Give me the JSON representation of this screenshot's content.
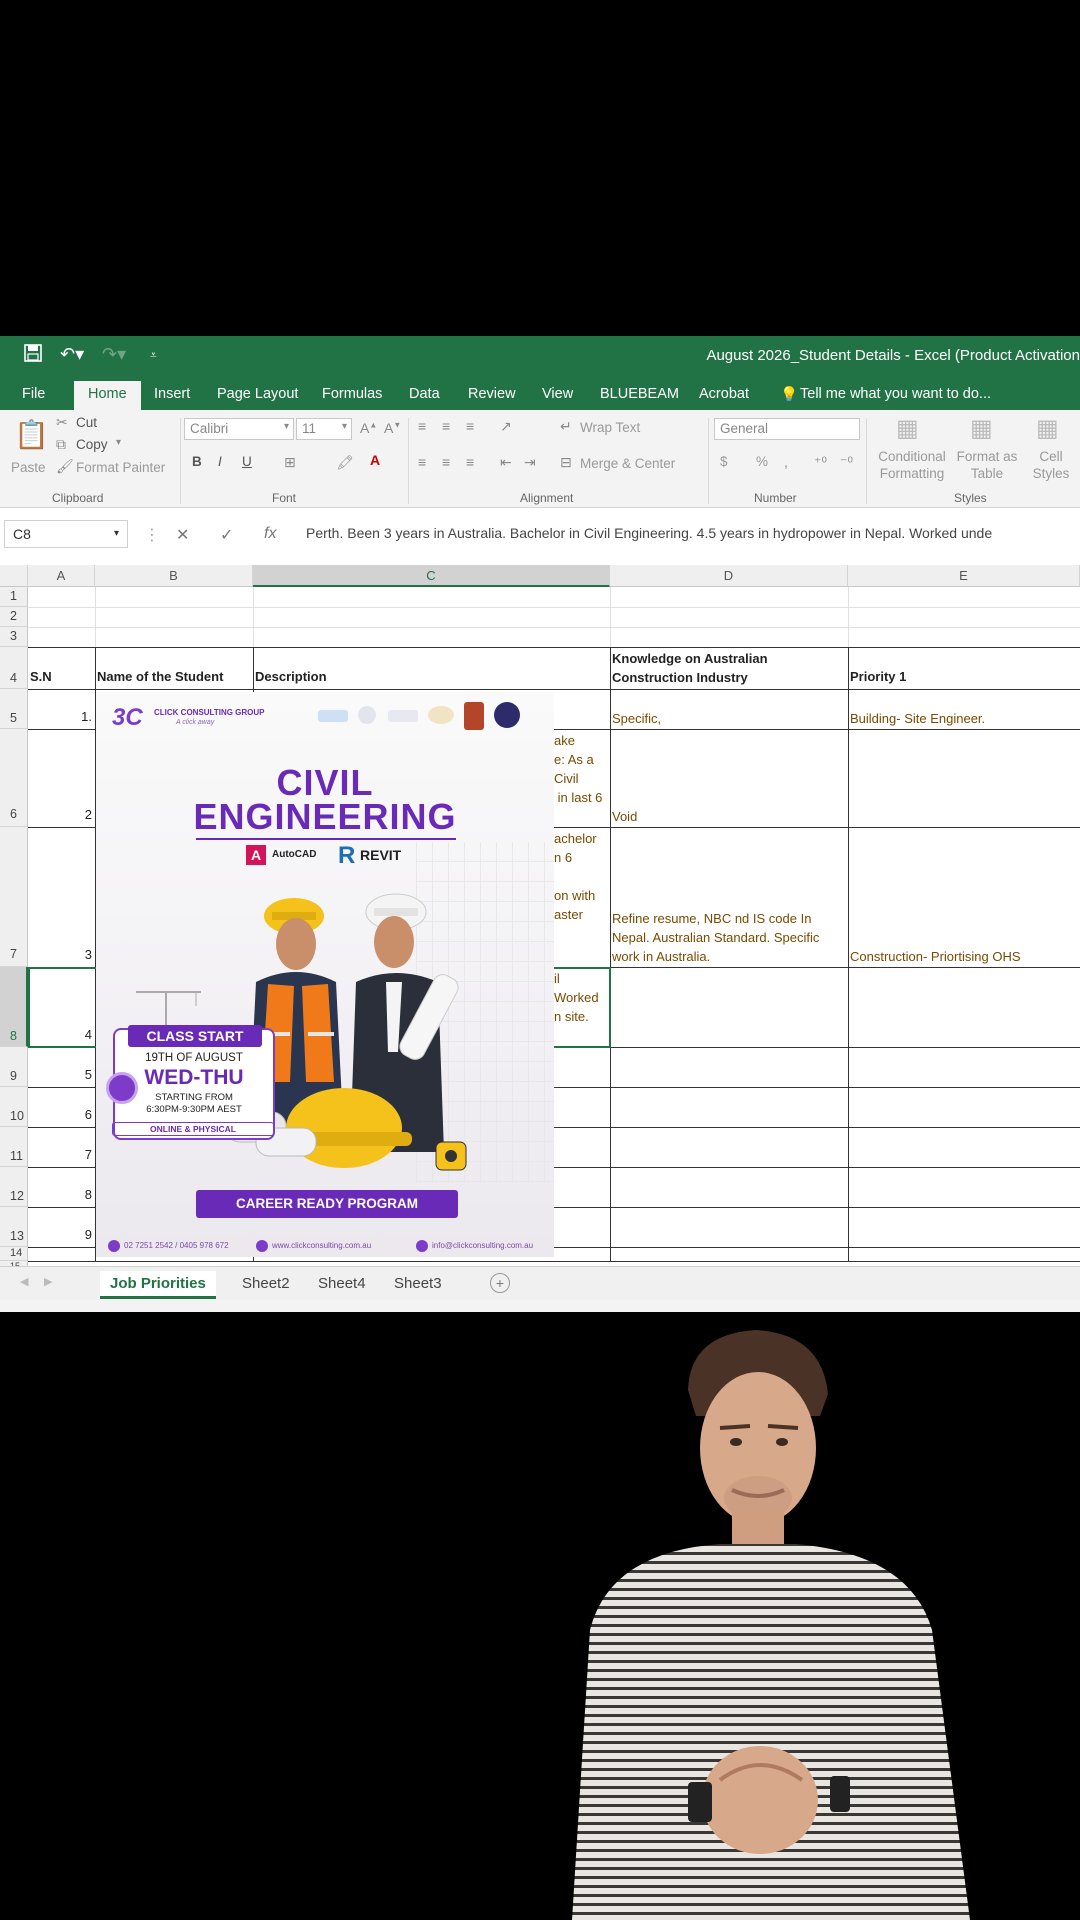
{
  "titlebar": {
    "title": "August 2026_Student Details - Excel (Product Activation"
  },
  "tabs": [
    {
      "label": "File"
    },
    {
      "label": "Home"
    },
    {
      "label": "Insert"
    },
    {
      "label": "Page Layout"
    },
    {
      "label": "Formulas"
    },
    {
      "label": "Data"
    },
    {
      "label": "Review"
    },
    {
      "label": "View"
    },
    {
      "label": "BLUEBEAM"
    },
    {
      "label": "Acrobat"
    },
    {
      "label": "Tell me what you want to do..."
    }
  ],
  "ribbon": {
    "clipboard": {
      "paste": "Paste",
      "cut": "Cut",
      "copy": "Copy",
      "format_painter": "Format Painter",
      "label": "Clipboard"
    },
    "font": {
      "name": "Calibri",
      "size": "11",
      "label": "Font",
      "bold": "B",
      "italic": "I",
      "underline": "U"
    },
    "alignment": {
      "wrap": "Wrap Text",
      "merge": "Merge & Center",
      "label": "Alignment"
    },
    "number": {
      "format": "General",
      "label": "Number",
      "currency": "$",
      "percent": "%"
    },
    "styles": {
      "conditional": "Conditional Formatting",
      "format_table": "Format as Table",
      "cell_styles": "Cell Styles",
      "label": "Styles"
    }
  },
  "formula_bar": {
    "name_box": "C8",
    "formula": "Perth. Been 3 years in Australia. Bachelor in Civil Engineering. 4.5 years in hydropower in Nepal. Worked unde"
  },
  "sheet": {
    "columns": [
      "A",
      "B",
      "C",
      "D",
      "E"
    ],
    "rows": [
      "1",
      "2",
      "3",
      "4",
      "5",
      "6",
      "7",
      "8",
      "9",
      "10",
      "11",
      "12",
      "13",
      "14",
      "15"
    ],
    "headers": {
      "sn": "S.N",
      "name": "Name of the Student",
      "description": "Description",
      "knowledge": "Knowledge on Australian Construction Industry",
      "priority": "Priority 1"
    },
    "row_numbers": [
      "1.",
      "2",
      "3",
      "4",
      "5",
      "6",
      "7",
      "8",
      "9"
    ],
    "desc_fragments": {
      "r6": "ake\ne: As a\nCivil\n in last 6",
      "r7": "achelor\nn 6\n\non with\naster",
      "r8": "il\nWorked\nn site."
    },
    "knowledge_cells": {
      "r5": "Specific,",
      "r6": "Void",
      "r7": "Refine resume, NBC nd IS code In Nepal. Australian Standard. Specific work in Australia."
    },
    "priority_cells": {
      "r5": "Building- Site Engineer.",
      "r7": "Construction- Priortising OHS"
    }
  },
  "sheet_tabs": [
    {
      "label": "Job Priorities",
      "active": true
    },
    {
      "label": "Sheet2"
    },
    {
      "label": "Sheet4"
    },
    {
      "label": "Sheet3"
    }
  ],
  "poster": {
    "brand": "CLICK CONSULTING GROUP",
    "brand_tag": "A click away",
    "brand_mark": "3C",
    "headline_1": "CIVIL",
    "headline_2": "ENGINEERING",
    "software_1": "AutoCAD",
    "software_2": "REVIT",
    "class_start": "CLASS START",
    "date": "19TH OF AUGUST",
    "days": "WED-THU",
    "starting_from": "STARTING FROM",
    "time": "6:30PM-9:30PM AEST",
    "mode": "ONLINE & PHYSICAL",
    "cta": "CAREER READY PROGRAM",
    "phone": "02 7251 2542 / 0405 978 672",
    "website": "www.clickconsulting.com.au",
    "email": "info@clickconsulting.com.au",
    "colors": {
      "purple": "#6a2ab8",
      "orange": "#f07a1a",
      "yellow": "#f4c21a"
    }
  },
  "colors": {
    "excel_green": "#217346",
    "ribbon_bg": "#f3f3f3"
  }
}
